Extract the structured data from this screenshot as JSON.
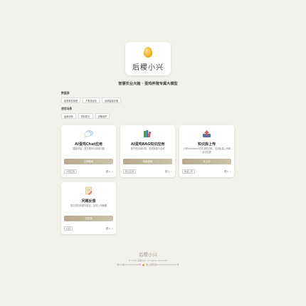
{
  "logo": {
    "name": "后稷小兴",
    "icon": "golden-egg-icon"
  },
  "subtitle": "智慧农业大脑 · 蛋鸡养殖专属大模型",
  "filters": [
    {
      "label": "数据源",
      "chips": [
        "智慧蛋禽管理",
        "产蛋量优化",
        "疾病智能诊断"
      ]
    },
    {
      "label": "使用场景",
      "chips": [
        "疫病诊断",
        "饲料配方",
        "设备维护"
      ]
    }
  ],
  "cards": [
    {
      "icon": "chat-bubble-icon",
      "title": "AI蛋鸡Chat应用",
      "desc": "智能对话，提交蛋鸡与场景问题",
      "button": "立即使用",
      "tag": "对话应用",
      "enter": "进入"
    },
    {
      "icon": "knowledge-books-icon",
      "title": "AI蛋鸡RAG知识应用",
      "desc": "基于知识库问答，查找资源与百科",
      "button": "检索使用",
      "tag": "知识应用",
      "enter": "进入"
    },
    {
      "icon": "upload-icon",
      "title": "知识库上传",
      "desc": "上传Markdown文件到知识库，支持批量上传和自动归类",
      "button": "去上传",
      "tag": "数据上传",
      "enter": "进入"
    },
    {
      "icon": "feedback-doc-icon",
      "title": "问题反馈",
      "desc": "提交您的问题与建议，支持上传截图",
      "button": "去反馈",
      "tag": "反馈",
      "enter": "进入"
    }
  ],
  "footer": {
    "brand": "后稷小兴",
    "copyright": "© 2024 后稷小兴. All rights reserved.",
    "icp": "豫ICP备2024XXXXXX号",
    "police": "豫公网安备41XXXXXXXXXXXX号"
  }
}
